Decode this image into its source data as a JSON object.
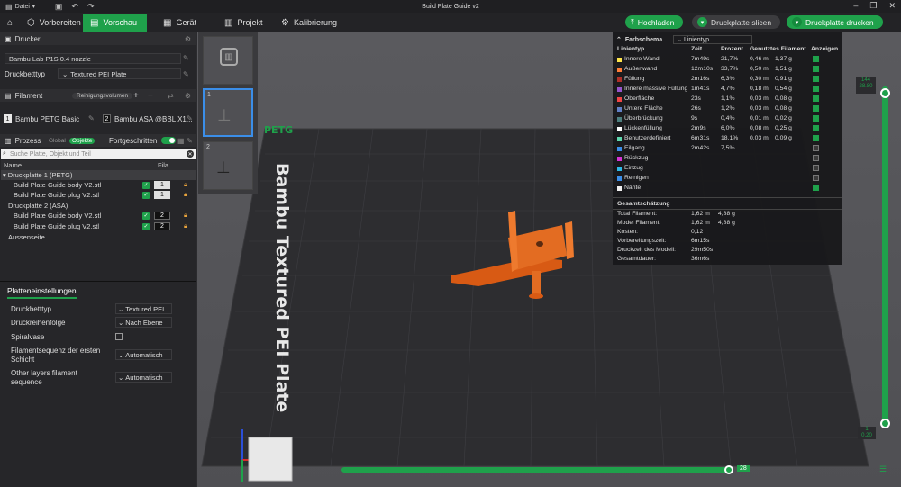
{
  "titlebar": {
    "file_menu": "Datei",
    "title": "Build Plate Guide v2"
  },
  "toolbar": {
    "tabs": [
      {
        "label": "Vorbereiten"
      },
      {
        "label": "Vorschau"
      },
      {
        "label": "Gerät"
      },
      {
        "label": "Projekt"
      },
      {
        "label": "Kalibrierung"
      }
    ],
    "upload": "Hochladen",
    "slice": "Druckplatte slicen",
    "print": "Druckplatte drucken"
  },
  "printer": {
    "section": "Drucker",
    "name": "Bambu Lab P1S 0.4 nozzle",
    "bed_label": "Druckbetttyp",
    "bed_value": "Textured PEI Plate"
  },
  "filament": {
    "section": "Filament",
    "purge_button": "Reinigungsvolumen",
    "items": [
      {
        "num": "1",
        "name": "Bambu PETG Basic"
      },
      {
        "num": "2",
        "name": "Bambu ASA @BBL X1..."
      }
    ]
  },
  "process": {
    "section": "Prozess",
    "global": "Global",
    "objects": "Objekte",
    "advanced": "Fortgeschritten",
    "search_placeholder": "Suche Platte, Objekt und Teil",
    "col_name": "Name",
    "col_fila": "Fila.",
    "tree": [
      {
        "label": "Druckplatte 1 (PETG)",
        "type": "plate"
      },
      {
        "label": "Build Plate Guide body V2.stl",
        "type": "obj",
        "fila": "1"
      },
      {
        "label": "Build Plate Guide plug V2.stl",
        "type": "obj",
        "fila": "1"
      },
      {
        "label": "Druckplatte 2 (ASA)",
        "type": "plate"
      },
      {
        "label": "Build Plate Guide body V2.stl",
        "type": "obj",
        "fila": "2"
      },
      {
        "label": "Build Plate Guide plug V2.stl",
        "type": "obj",
        "fila": "2"
      },
      {
        "label": "Aussenseite",
        "type": "plate"
      }
    ]
  },
  "plate_settings": {
    "tab": "Platteneinstellungen",
    "rows": [
      {
        "label": "Druckbetttyp",
        "value": "Textured PEI..."
      },
      {
        "label": "Druckreihenfolge",
        "value": "Nach Ebene"
      },
      {
        "label": "Spiralvase",
        "value": ""
      },
      {
        "label": "Filamentsequenz der ersten Schicht",
        "value": "Automatisch"
      },
      {
        "label": "Other layers filament sequence",
        "value": "Automatisch"
      }
    ]
  },
  "plates": [
    {
      "num": ""
    },
    {
      "num": "1"
    },
    {
      "num": "2"
    }
  ],
  "viewport": {
    "petg_label": "PETG",
    "bed_text": "Bambu Textured PEI Plate",
    "vslider_top": "144\n28.80",
    "vslider_bottom": "1\n0.20",
    "hslider_value": "28"
  },
  "legend": {
    "title": "Farbschema",
    "scheme": "Linientyp",
    "headers": [
      "Linientyp",
      "Zeit",
      "Prozent",
      "Genutztes Filament",
      "Anzeigen"
    ],
    "rows": [
      {
        "name": "Innere Wand",
        "color": "#ffe54a",
        "time": "7m49s",
        "pct": "21,7%",
        "len": "0,46 m",
        "wt": "1,37 g",
        "show": true
      },
      {
        "name": "Außenwand",
        "color": "#ff7d38",
        "time": "12m10s",
        "pct": "33,7%",
        "len": "0,50 m",
        "wt": "1,51 g",
        "show": true
      },
      {
        "name": "Füllung",
        "color": "#b03029",
        "time": "2m16s",
        "pct": "6,3%",
        "len": "0,30 m",
        "wt": "0,91 g",
        "show": true
      },
      {
        "name": "Innere massive Füllung",
        "color": "#9654cc",
        "time": "1m41s",
        "pct": "4,7%",
        "len": "0,18 m",
        "wt": "0,54 g",
        "show": true
      },
      {
        "name": "Oberfläche",
        "color": "#f04545",
        "time": "23s",
        "pct": "1,1%",
        "len": "0,03 m",
        "wt": "0,08 g",
        "show": true
      },
      {
        "name": "Untere Fläche",
        "color": "#6180c7",
        "time": "26s",
        "pct": "1,2%",
        "len": "0,03 m",
        "wt": "0,08 g",
        "show": true
      },
      {
        "name": "Überbrückung",
        "color": "#4d8080",
        "time": "9s",
        "pct": "0,4%",
        "len": "0,01 m",
        "wt": "0,02 g",
        "show": true
      },
      {
        "name": "Lückenfüllung",
        "color": "#ffffff",
        "time": "2m9s",
        "pct": "6,0%",
        "len": "0,08 m",
        "wt": "0,25 g",
        "show": true
      },
      {
        "name": "Benutzerdefiniert",
        "color": "#5ed6ad",
        "time": "6m31s",
        "pct": "18,1%",
        "len": "0,03 m",
        "wt": "0,09 g",
        "show": true
      },
      {
        "name": "Eilgang",
        "color": "#3b8ee8",
        "time": "2m42s",
        "pct": "7,5%",
        "len": "",
        "wt": "",
        "show": false
      },
      {
        "name": "Rückzug",
        "color": "#d633d6",
        "time": "",
        "pct": "",
        "len": "",
        "wt": "",
        "show": false
      },
      {
        "name": "Einzug",
        "color": "#2eb8e6",
        "time": "",
        "pct": "",
        "len": "",
        "wt": "",
        "show": false
      },
      {
        "name": "Reinigen",
        "color": "#3b8ee8",
        "time": "",
        "pct": "",
        "len": "",
        "wt": "",
        "show": false
      },
      {
        "name": "Nähte",
        "color": "#f0f0f0",
        "time": "",
        "pct": "",
        "len": "",
        "wt": "",
        "show": true
      }
    ],
    "summary_title": "Gesamtschätzung",
    "summary": [
      {
        "label": "Total Filament:",
        "v1": "1,62 m",
        "v2": "4,88 g"
      },
      {
        "label": "Model Filament:",
        "v1": "1,62 m",
        "v2": "4,88 g"
      },
      {
        "label": "Kosten:",
        "v1": "0,12",
        "v2": ""
      },
      {
        "label": "Vorbereitungszeit:",
        "v1": "6m15s",
        "v2": ""
      },
      {
        "label": "Druckzeit des Modell:",
        "v1": "29m50s",
        "v2": ""
      },
      {
        "label": "Gesamtdauer:",
        "v1": "36m6s",
        "v2": ""
      }
    ]
  }
}
